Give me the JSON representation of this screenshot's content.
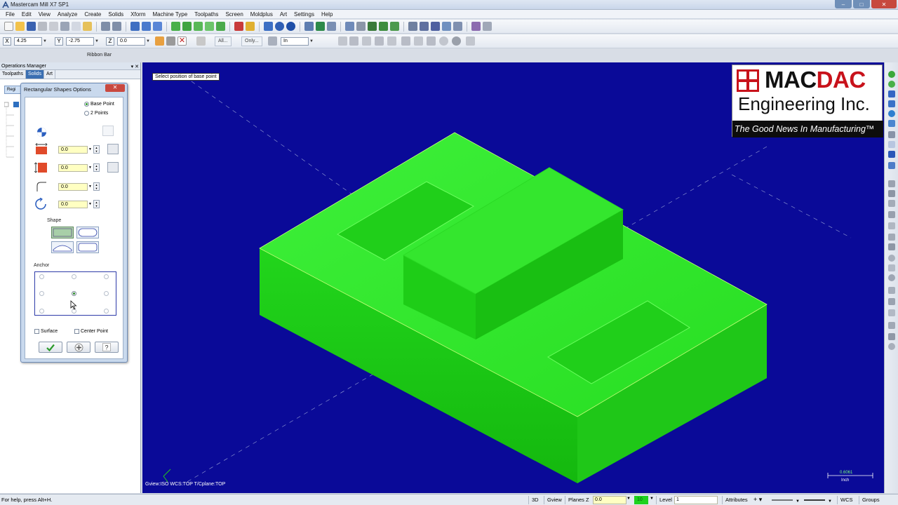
{
  "window": {
    "title": "Mastercam Mill X7 SP1",
    "controls": [
      "–",
      "□",
      "✕"
    ]
  },
  "menu": [
    "File",
    "Edit",
    "View",
    "Analyze",
    "Create",
    "Solids",
    "Xform",
    "Machine Type",
    "Toolpaths",
    "Screen",
    "Moldplus",
    "Art",
    "Settings",
    "Help"
  ],
  "ribbon": {
    "x_label": "X",
    "x_value": "4.25",
    "y_label": "Y",
    "y_value": "-2.75",
    "z_label": "Z",
    "z_value": "0.0",
    "all_button": "All...",
    "only_button": "Only...",
    "units_value": "In",
    "ribbon_bar_label": "Ribbon Bar"
  },
  "left_panel": {
    "header": "Operations Manager",
    "tabs": [
      "Toolpaths",
      "Solids",
      "Art"
    ],
    "active_tab": "Solids",
    "region_button": "Regi"
  },
  "dialog": {
    "title": "Rectangular Shapes Options",
    "close": "✕",
    "radio_base_point": "Base Point",
    "radio_2_points": "2 Points",
    "width_value": "0.0",
    "height_value": "0.0",
    "radius_value": "0.0",
    "angle_value": "0.0",
    "shape_label": "Shape",
    "anchor_label": "Anchor",
    "surface_label": "Surface",
    "center_point_label": "Center Point"
  },
  "viewport": {
    "prompt": "Select position of base point",
    "status": "Gview:ISO   WCS:TOP   T/Cplane:TOP",
    "scale_value": "0.6061",
    "scale_unit": "Inch",
    "background": "#0a0a98",
    "part_color": "#22e81a"
  },
  "logo": {
    "brand_left": "MAC",
    "brand_right": "DAC",
    "company": "Engineering Inc.",
    "tagline": "The Good News In Manufacturing™"
  },
  "statusbar": {
    "help": "For help, press Alt+H.",
    "mode_3d": "3D",
    "gview": "Gview",
    "planes": "Planes",
    "z_label": "Z",
    "z_value": "0.0",
    "color_value": "10",
    "level_label": "Level",
    "level_value": "1",
    "attributes": "Attributes",
    "wcs": "WCS",
    "groups": "Groups"
  }
}
